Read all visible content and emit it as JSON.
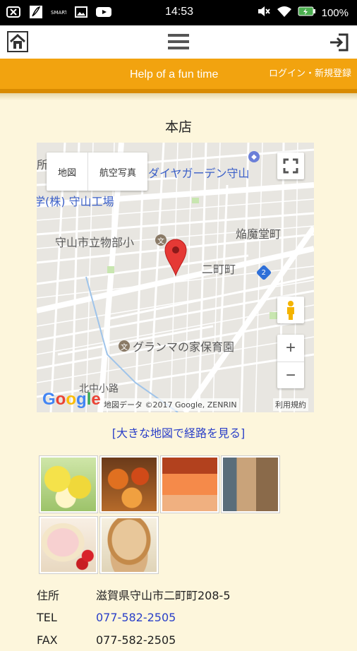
{
  "status_bar": {
    "time": "14:53",
    "battery": "100%",
    "left_icons": [
      "close-box-icon",
      "feather-app-icon",
      "news-app-icon",
      "image-icon",
      "youtube-icon"
    ],
    "right_icons": [
      "mute-icon",
      "wifi-icon",
      "battery-icon"
    ]
  },
  "toolbar": {
    "icons": [
      "home-icon",
      "hamburger-menu-icon",
      "login-arrow-icon"
    ]
  },
  "header": {
    "title": "Help of a fun time",
    "login_link": "ログイン・新規登録",
    "color": "#f2a30f"
  },
  "store": {
    "name": "本店"
  },
  "map": {
    "type_buttons": [
      "地図",
      "航空写真"
    ],
    "labels": {
      "garden": "ダイヤガーデン守山",
      "factory": "学(株) 守山工場",
      "school": "守山市立物部小",
      "enma": "焔魔堂町",
      "nichome": "二町町",
      "nursery": "グランマの家保育園",
      "kitanaka": "北中小路",
      "left_edge": "所"
    },
    "route_badge": "2",
    "zoom_in": "+",
    "zoom_out": "−",
    "logo": "Google",
    "credit": "地図データ ©2017 Google, ZENRIN",
    "terms": "利用規約"
  },
  "big_map_link": "[大きな地図で経路を見る]",
  "gallery": [
    {
      "name": "lemon-cakes"
    },
    {
      "name": "fruit-tarts"
    },
    {
      "name": "orange-jellies"
    },
    {
      "name": "storefront"
    },
    {
      "name": "strawberry-roll-cake"
    },
    {
      "name": "dorayaki"
    }
  ],
  "info": {
    "address_label": "住所",
    "address": "滋賀県守山市二町町208-5",
    "tel_label": "TEL",
    "tel": "077-582-2505",
    "fax_label": "FAX",
    "fax": "077-582-2505"
  }
}
